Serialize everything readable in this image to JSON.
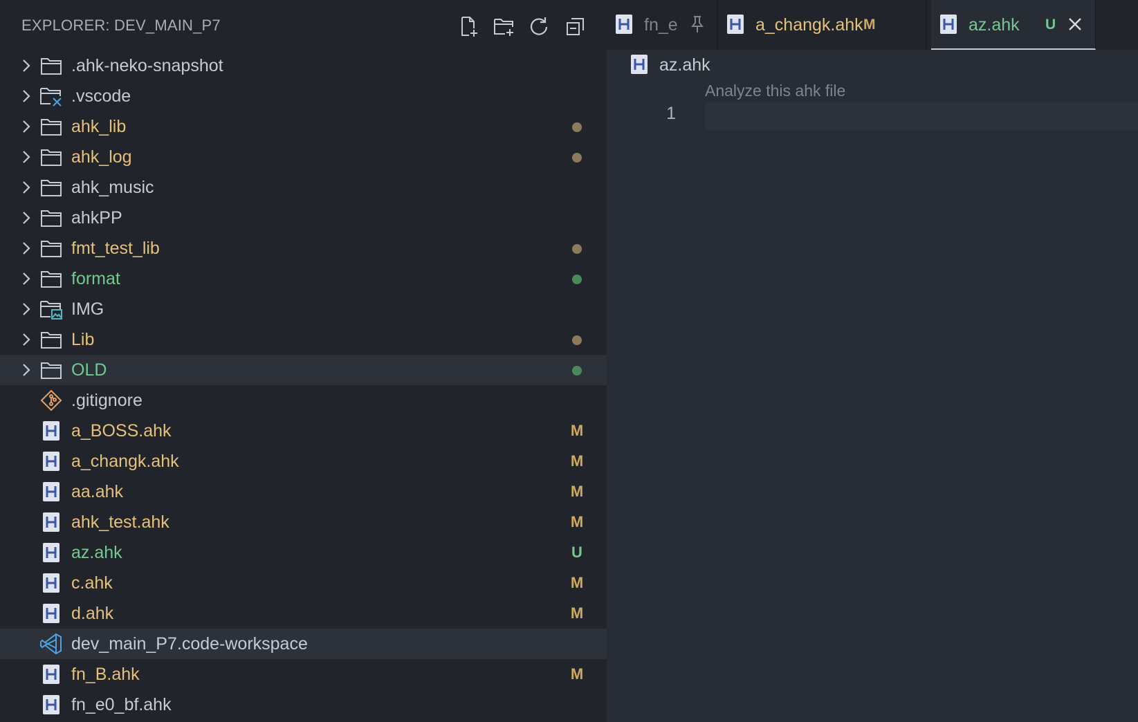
{
  "explorer": {
    "title": "EXPLORER: DEV_MAIN_P7",
    "actions": [
      "new-file-icon",
      "new-folder-icon",
      "refresh-icon",
      "collapse-all-icon"
    ],
    "items": [
      {
        "label": ".ahk-neko-snapshot",
        "type": "folder",
        "icon": "folder-icon",
        "color": "#c5cad3"
      },
      {
        "label": ".vscode",
        "type": "folder",
        "icon": "folder-vscode-icon",
        "color": "#c5cad3"
      },
      {
        "label": "ahk_lib",
        "type": "folder",
        "icon": "folder-icon",
        "color": "#e5c07b",
        "dot": "#8c7a5b"
      },
      {
        "label": "ahk_log",
        "type": "folder",
        "icon": "folder-icon",
        "color": "#e5c07b",
        "dot": "#8c7a5b"
      },
      {
        "label": "ahk_music",
        "type": "folder",
        "icon": "folder-icon",
        "color": "#c5cad3"
      },
      {
        "label": "ahkPP",
        "type": "folder",
        "icon": "folder-icon",
        "color": "#c5cad3"
      },
      {
        "label": "fmt_test_lib",
        "type": "folder",
        "icon": "folder-icon",
        "color": "#e5c07b",
        "dot": "#8c7a5b"
      },
      {
        "label": "format",
        "type": "folder",
        "icon": "folder-icon",
        "color": "#73c991",
        "dot": "#4a8a5a"
      },
      {
        "label": "IMG",
        "type": "folder",
        "icon": "folder-images-icon",
        "color": "#c5cad3"
      },
      {
        "label": "Lib",
        "type": "folder",
        "icon": "folder-icon",
        "color": "#e5c07b",
        "dot": "#8c7a5b"
      },
      {
        "label": "OLD",
        "type": "folder",
        "icon": "folder-icon",
        "color": "#73c991",
        "dot": "#4a8a5a",
        "hover": true
      },
      {
        "label": ".gitignore",
        "type": "file",
        "icon": "git-icon",
        "color": "#c5cad3"
      },
      {
        "label": "a_BOSS.ahk",
        "type": "file",
        "icon": "ahk-file-icon",
        "color": "#e5c07b",
        "badge": "M"
      },
      {
        "label": "a_changk.ahk",
        "type": "file",
        "icon": "ahk-file-icon",
        "color": "#e5c07b",
        "badge": "M"
      },
      {
        "label": "aa.ahk",
        "type": "file",
        "icon": "ahk-file-icon",
        "color": "#e5c07b",
        "badge": "M"
      },
      {
        "label": "ahk_test.ahk",
        "type": "file",
        "icon": "ahk-file-icon",
        "color": "#e5c07b",
        "badge": "M"
      },
      {
        "label": "az.ahk",
        "type": "file",
        "icon": "ahk-file-icon",
        "color": "#73c991",
        "badge": "U"
      },
      {
        "label": "c.ahk",
        "type": "file",
        "icon": "ahk-file-icon",
        "color": "#e5c07b",
        "badge": "M"
      },
      {
        "label": "d.ahk",
        "type": "file",
        "icon": "ahk-file-icon",
        "color": "#e5c07b",
        "badge": "M"
      },
      {
        "label": "dev_main_P7.code-workspace",
        "type": "file",
        "icon": "vscode-workspace-icon",
        "color": "#c5cad3",
        "hover": true
      },
      {
        "label": "fn_B.ahk",
        "type": "file",
        "icon": "ahk-file-icon",
        "color": "#e5c07b",
        "badge": "M"
      },
      {
        "label": "fn_e0_bf.ahk",
        "type": "file",
        "icon": "ahk-file-icon",
        "color": "#c5cad3"
      }
    ]
  },
  "editor": {
    "tabs": [
      {
        "label": "fn_e",
        "status": "",
        "color": "#7f848e",
        "action": "pin-icon",
        "active": false
      },
      {
        "label": "a_changk.ahk",
        "status": "M",
        "color": "#e5c07b",
        "action": "",
        "active": false
      },
      {
        "label": "az.ahk",
        "status": "U",
        "color": "#73c991",
        "action": "close-icon",
        "active": true
      }
    ],
    "breadcrumb": "az.ahk",
    "hint": "Analyze this ahk file",
    "line_number": "1"
  },
  "colors": {
    "modified": "#e5c07b",
    "untracked": "#73c991",
    "badge_modified": "#d1a85f",
    "badge_untracked": "#73c991"
  }
}
